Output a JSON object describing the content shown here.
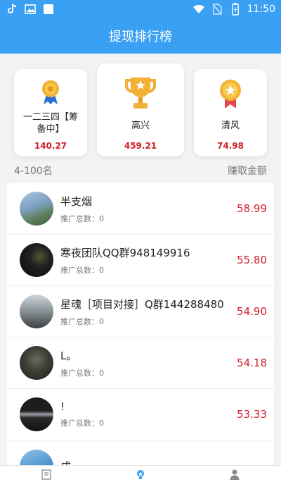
{
  "status_bar": {
    "time": "11:50"
  },
  "header": {
    "title": "提现排行榜"
  },
  "top3": [
    {
      "name": "一二三四【筹备中】",
      "amount": "140.27"
    },
    {
      "name": "高兴",
      "amount": "459.21"
    },
    {
      "name": "清风",
      "amount": "74.98"
    }
  ],
  "list_header": {
    "range": "4-100名",
    "amount_label": "赚取金额"
  },
  "rows": [
    {
      "name": "半支烟",
      "promo": "推广总数：0",
      "amount": "58.99"
    },
    {
      "name": "寒夜团队QQ群948149916",
      "promo": "推广总数：0",
      "amount": "55.80"
    },
    {
      "name": "星魂［项目对接］Q群144288480",
      "promo": "推广总数：0",
      "amount": "54.90"
    },
    {
      "name": "L。",
      "promo": "推广总数：0",
      "amount": "54.18"
    },
    {
      "name": "!",
      "promo": "推广总数：0",
      "amount": "53.33"
    },
    {
      "name": "成"
    }
  ],
  "colors": {
    "header_bg": "#3aa0f3",
    "amount": "#d0202a"
  },
  "icons": [
    "tiktok-icon",
    "image-icon",
    "square-icon",
    "wifi-icon",
    "no-sim-icon",
    "battery-icon",
    "medal-icon",
    "trophy-icon",
    "badge-icon",
    "list-tab-icon",
    "rank-tab-icon",
    "user-tab-icon"
  ]
}
